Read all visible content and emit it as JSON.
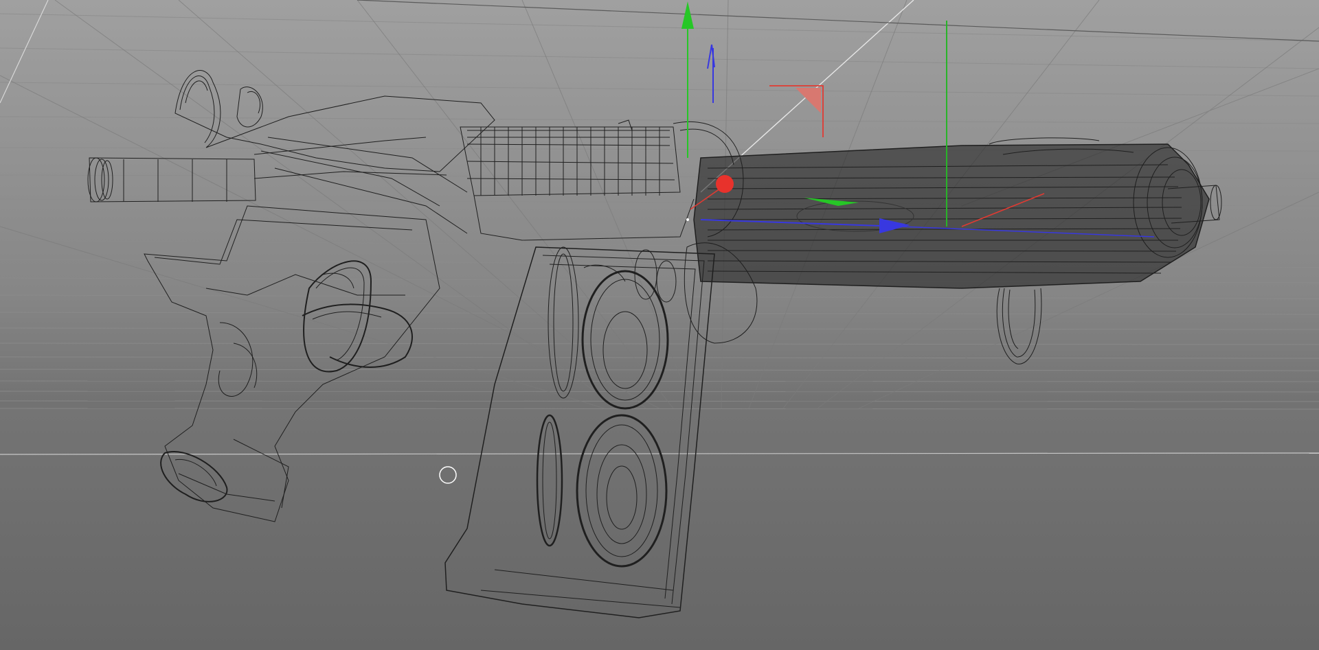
{
  "app": {
    "view": "3d-viewport",
    "display_mode": "wireframe"
  },
  "scene": {
    "object": "pistol",
    "parts": [
      "stock",
      "receiver",
      "magazine",
      "barrel",
      "trigger-guard",
      "front-sling-loop"
    ],
    "selected": "barrel"
  },
  "gizmo": {
    "type": "move",
    "axes": [
      "x",
      "y",
      "z"
    ]
  },
  "colors": {
    "background_top": "#a0a0a0",
    "background_bottom": "#6a6a6a",
    "floor": "#6b6b6b",
    "wire": "#1f1f1f",
    "grid": "#8d8d8d",
    "axis_x": "#e23a32",
    "axis_y": "#26c726",
    "axis_z": "#3838e0",
    "pivot": "#e8322c"
  },
  "icons": {
    "gizmo": "move-gizmo-icon",
    "cursor": "cursor-ring-icon"
  }
}
